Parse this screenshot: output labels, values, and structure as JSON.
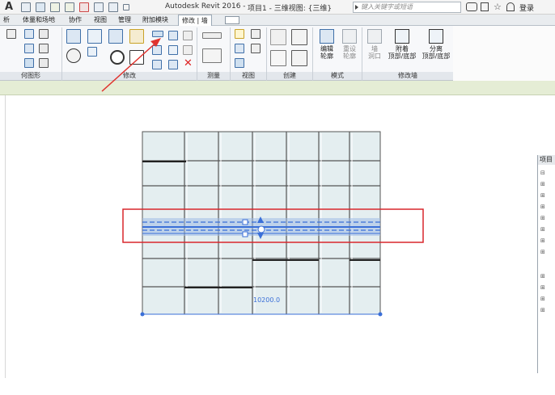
{
  "titlebar": {
    "app_title": "Autodesk Revit 2016 -",
    "doc_title": "项目1 - 三维视图: {三维}",
    "search_placeholder": "键入关键字或短语",
    "signin": "登录"
  },
  "tabs": [
    {
      "label": "析"
    },
    {
      "label": "体量和场地"
    },
    {
      "label": "协作"
    },
    {
      "label": "视图"
    },
    {
      "label": "管理"
    },
    {
      "label": "附加模块"
    },
    {
      "label": "修改 | 墙"
    }
  ],
  "ribbon": {
    "groups": [
      {
        "label": "何图形"
      },
      {
        "label": "修改"
      },
      {
        "label": "测量"
      },
      {
        "label": "视图"
      },
      {
        "label": "创建"
      },
      {
        "label": "模式"
      },
      {
        "label": "修改墙"
      }
    ],
    "buttons": {
      "edit_profile": "编辑\n轮廓",
      "reset_profile": "重设\n轮廓",
      "wall_opening": "墙\n洞口",
      "attach_top_base": "附着\n顶部/底部",
      "detach_top_base": "分离\n顶部/底部"
    }
  },
  "canvas": {
    "dimension_text": "10200.0"
  },
  "browser": {
    "title": "项目"
  },
  "colors": {
    "highlight_box": "#d9262c",
    "arrow": "#e0332e",
    "selected_wall": "#3a6fd8",
    "panel_fill": "#e4eef0"
  }
}
